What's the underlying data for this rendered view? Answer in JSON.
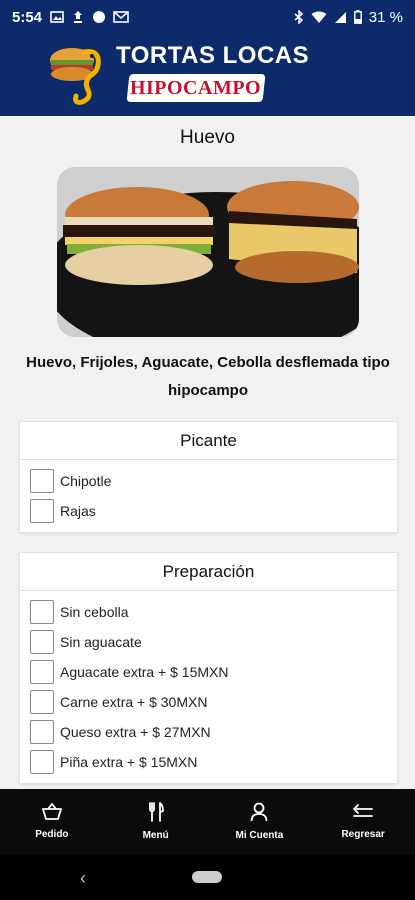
{
  "status": {
    "time": "5:54",
    "battery": "31 %"
  },
  "header": {
    "brand_line1": "TORTAS LOCAS",
    "brand_line2": "HIPOCAMPO"
  },
  "product": {
    "title": "Huevo",
    "description": "Huevo, Frijoles, Aguacate, Cebolla desflemada tipo hipocampo"
  },
  "sections": {
    "picante": {
      "title": "Picante",
      "options": [
        "Chipotle",
        "Rajas"
      ]
    },
    "preparacion": {
      "title": "Preparación",
      "options": [
        "Sin cebolla",
        "Sin aguacate",
        "Aguacate extra + $ 15MXN",
        "Carne extra + $ 30MXN",
        "Queso extra + $ 27MXN",
        "Piña extra + $ 15MXN"
      ]
    }
  },
  "nav": {
    "items": [
      {
        "label": "Pedido",
        "icon": "basket-icon"
      },
      {
        "label": "Menú",
        "icon": "utensils-icon"
      },
      {
        "label": "Mi Cuenta",
        "icon": "user-icon"
      },
      {
        "label": "Regresar",
        "icon": "return-icon"
      }
    ]
  },
  "colors": {
    "header_bg": "#0d2a6b",
    "ribbon_text": "#c8102e",
    "nav_bg": "#0b0b0b"
  }
}
